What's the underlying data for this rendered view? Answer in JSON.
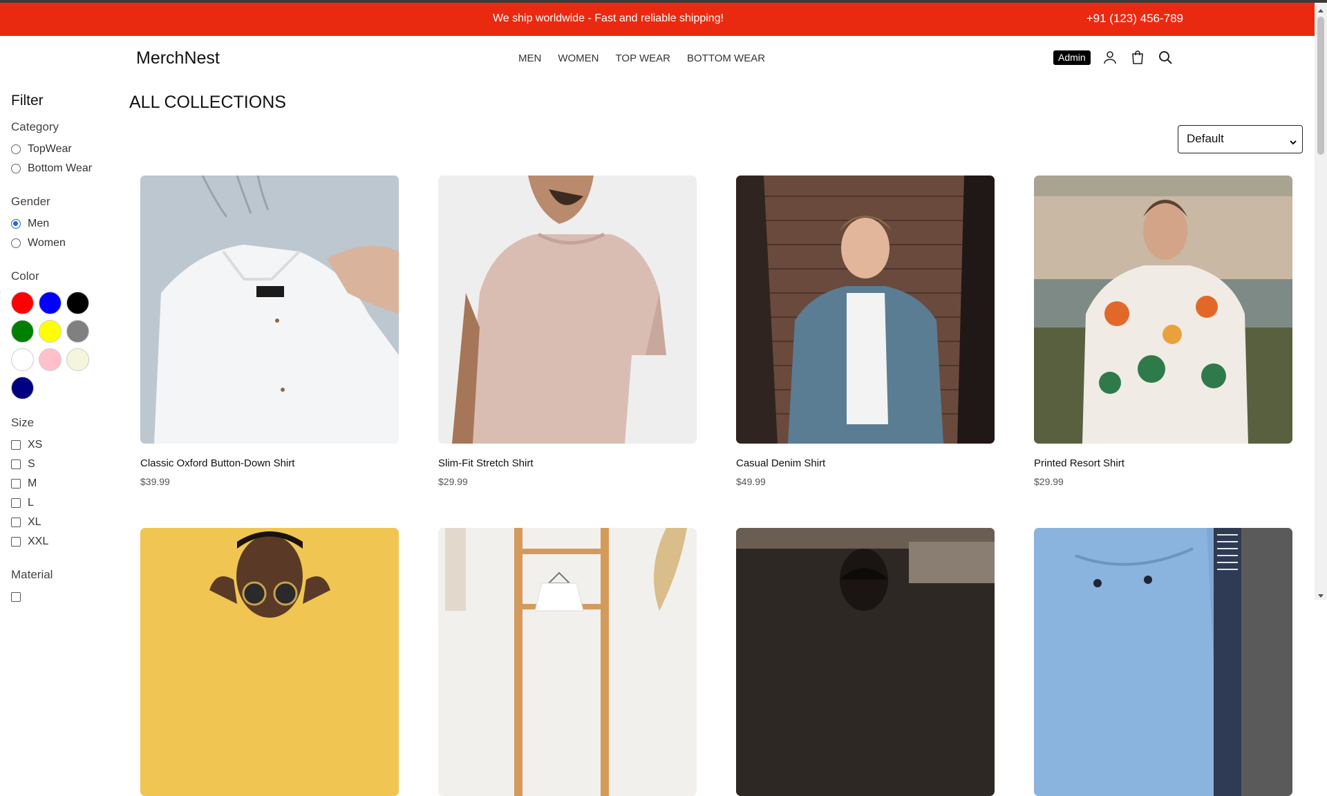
{
  "announcement": {
    "message": "We ship worldwide - Fast and reliable shipping!",
    "phone": "+91 (123) 456-789"
  },
  "header": {
    "logo": "MerchNest",
    "nav": [
      "MEN",
      "WOMEN",
      "TOP WEAR",
      "BOTTOM WEAR"
    ],
    "admin_label": "Admin",
    "icons": [
      "user-icon",
      "shopping-bag-icon",
      "search-icon"
    ]
  },
  "filter": {
    "title": "Filter",
    "category": {
      "title": "Category",
      "options": [
        "TopWear",
        "Bottom Wear"
      ],
      "selected": null
    },
    "gender": {
      "title": "Gender",
      "options": [
        "Men",
        "Women"
      ],
      "selected": "Men"
    },
    "color": {
      "title": "Color",
      "swatches": [
        "#ff0000",
        "#0000ff",
        "#000000",
        "#008000",
        "#ffff00",
        "#808080",
        "#ffffff",
        "#ffc0cb",
        "#f5f5dc",
        "#000080"
      ]
    },
    "size": {
      "title": "Size",
      "options": [
        "XS",
        "S",
        "M",
        "L",
        "XL",
        "XXL"
      ]
    },
    "material": {
      "title": "Material"
    }
  },
  "main": {
    "title": "ALL COLLECTIONS",
    "sort": {
      "selected": "Default"
    },
    "products": [
      {
        "name": "Classic Oxford Button-Down Shirt",
        "price": "$39.99"
      },
      {
        "name": "Slim-Fit Stretch Shirt",
        "price": "$29.99"
      },
      {
        "name": "Casual Denim Shirt",
        "price": "$49.99"
      },
      {
        "name": "Printed Resort Shirt",
        "price": "$29.99"
      }
    ]
  },
  "colors": {
    "accent": "#ea2a10"
  }
}
